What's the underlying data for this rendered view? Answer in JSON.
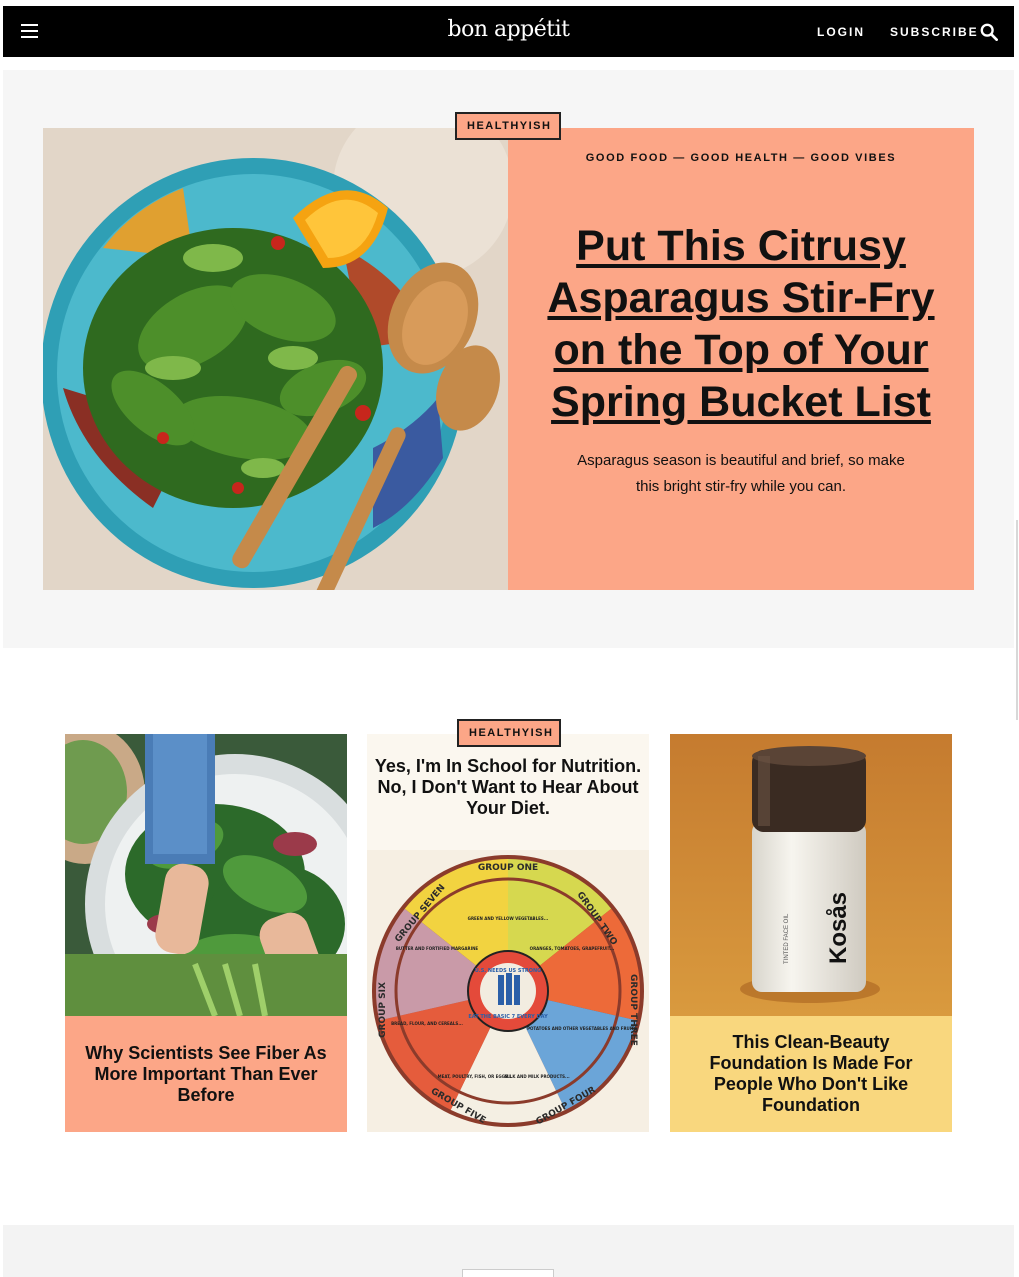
{
  "header": {
    "logo": "bon appétit",
    "login_label": "LOGIN",
    "subscribe_label": "SUBSCRIBE",
    "menu_icon": "hamburger-menu-icon",
    "search_icon": "search-icon"
  },
  "hero": {
    "tag": "HEALTHYISH",
    "kicker": "GOOD FOOD — GOOD HEALTH — GOOD VIBES",
    "title": "Put This Citrusy Asparagus Stir-Fry on the Top of Your Spring Bucket List",
    "description": "Asparagus season is beautiful and brief, so make this bright stir-fry while you can.",
    "panel_color": "#fca687"
  },
  "cards": {
    "tag": "HEALTHYISH",
    "items": [
      {
        "title": "Why Scientists See Fiber As More Important Than Ever Before",
        "caption_color": "#fca687"
      },
      {
        "title": "Yes, I'm In School for Nutrition. No, I Don't Want to Hear About Your Diet."
      },
      {
        "title": "This Clean-Beauty Foundation Is Made For People Who Don't Like Foundation",
        "caption_color": "#f9d77e"
      }
    ]
  },
  "food_wheel": {
    "center_line1": "U.S. NEEDS US STRONG",
    "center_line2": "EAT THE BASIC 7 EVERY DAY",
    "groups": [
      "GROUP ONE",
      "GROUP TWO",
      "GROUP THREE",
      "GROUP FOUR",
      "GROUP FIVE",
      "GROUP SIX",
      "GROUP SEVEN"
    ],
    "segment_labels": [
      "GREEN AND YELLOW VEGETABLES...",
      "ORANGES, TOMATOES, GRAPEFRUIT...",
      "POTATOES AND OTHER VEGETABLES AND FRUITS",
      "MILK AND MILK PRODUCTS...",
      "MEAT, POULTRY, FISH, OR EGGS...",
      "BREAD, FLOUR, AND CEREALS...",
      "BUTTER AND FORTIFIED MARGARINE"
    ]
  },
  "product": {
    "brand": "Kosås",
    "label": "TINTED FACE OIL"
  }
}
